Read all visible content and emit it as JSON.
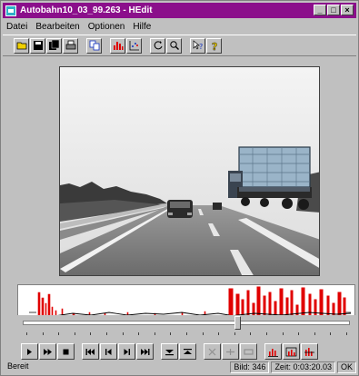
{
  "window": {
    "title": "Autobahn10_03_99.263 - HEdit",
    "controls": {
      "minimize": "_",
      "maximize": "□",
      "close": "×"
    }
  },
  "menu": {
    "items": [
      {
        "label": "Datei"
      },
      {
        "label": "Bearbeiten"
      },
      {
        "label": "Optionen"
      },
      {
        "label": "Hilfe"
      }
    ]
  },
  "toolbar": {
    "icons": [
      "open-folder-icon",
      "save-icon",
      "save-all-icon",
      "print-icon",
      "copy-icon",
      "histogram-icon",
      "scatter-icon",
      "rotate-icon",
      "zoom-icon",
      "help-pointer-icon",
      "help-icon"
    ],
    "colors": {
      "red": "#e00000",
      "yellow": "#f0d000",
      "blue": "#1030c0"
    }
  },
  "video": {
    "description_icon": "video-frame"
  },
  "transport": {
    "buttons": [
      {
        "name": "play",
        "icon": "play-icon",
        "glyph": "▶"
      },
      {
        "name": "fast-forward",
        "icon": "fast-forward-icon",
        "glyph": "▶▶"
      },
      {
        "name": "stop",
        "icon": "stop-icon",
        "glyph": "■"
      },
      {
        "name": "first",
        "icon": "skip-first-icon",
        "glyph": "|◀◀"
      },
      {
        "name": "prev",
        "icon": "step-back-icon",
        "glyph": "|◀"
      },
      {
        "name": "next",
        "icon": "step-forward-icon",
        "glyph": "▶|"
      },
      {
        "name": "last",
        "icon": "skip-last-icon",
        "glyph": "▶▶|"
      }
    ]
  },
  "slider": {
    "position": 0.655
  },
  "status": {
    "ready": "Bereit",
    "frame": "Bild: 346",
    "time": "Zeit: 0:03:20.03",
    "ok": "OK"
  }
}
